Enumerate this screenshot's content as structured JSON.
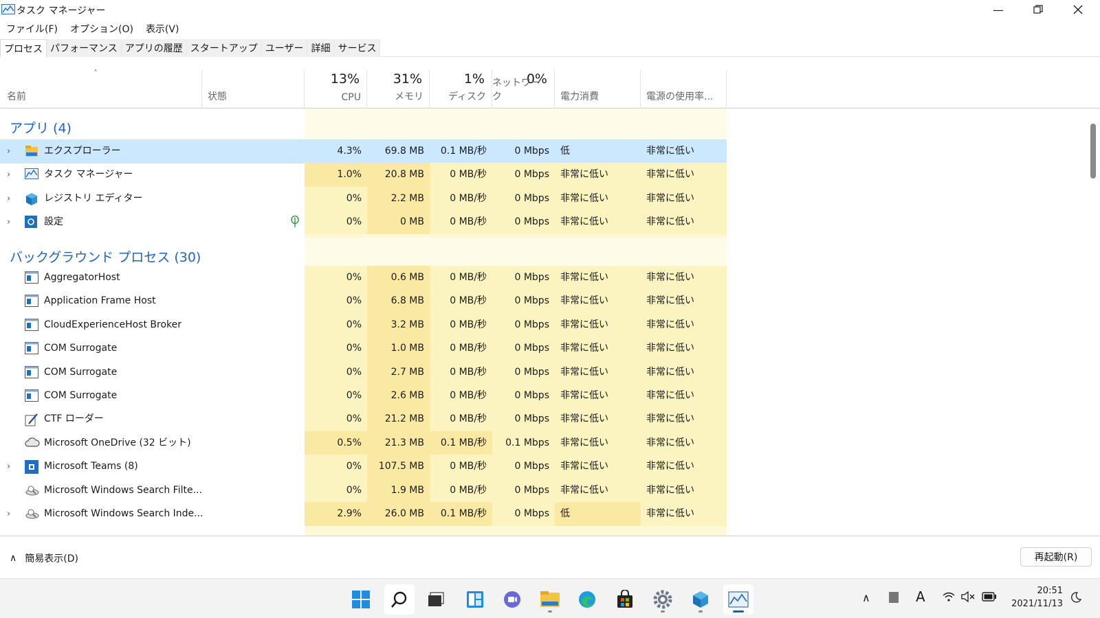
{
  "window": {
    "title": "タスク マネージャー",
    "minimize_icon": "minimize-icon",
    "maximize_icon": "restore-icon",
    "close_icon": "close-icon"
  },
  "menu": [
    "ファイル(F)",
    "オプション(O)",
    "表示(V)"
  ],
  "tabs": [
    "プロセス",
    "パフォーマンス",
    "アプリの履歴",
    "スタートアップ",
    "ユーザー",
    "詳細",
    "サービス"
  ],
  "active_tab": "プロセス",
  "columns": {
    "name": "名前",
    "status": "状態",
    "cpu_pct": "13%",
    "cpu": "CPU",
    "mem_pct": "31%",
    "mem": "メモリ",
    "disk_pct": "1%",
    "disk": "ディスク",
    "net_pct": "0%",
    "net": "ネットワーク",
    "power": "電力消費",
    "power_trend": "電源の使用率..."
  },
  "groups": {
    "apps": "アプリ (4)",
    "background": "バックグラウンド プロセス (30)"
  },
  "apps": [
    {
      "name": "エクスプローラー",
      "icon": "folder-icon",
      "expand": true,
      "cpu": "4.3%",
      "mem": "69.8 MB",
      "disk": "0.1 MB/秒",
      "net": "0 Mbps",
      "power": "低",
      "trend": "非常に低い",
      "selected": true
    },
    {
      "name": "タスク マネージャー",
      "icon": "task-manager-icon",
      "expand": true,
      "cpu": "1.0%",
      "mem": "20.8 MB",
      "disk": "0 MB/秒",
      "net": "0 Mbps",
      "power": "非常に低い",
      "trend": "非常に低い"
    },
    {
      "name": "レジストリ エディター",
      "icon": "registry-icon",
      "expand": true,
      "cpu": "0%",
      "mem": "2.2 MB",
      "disk": "0 MB/秒",
      "net": "0 Mbps",
      "power": "非常に低い",
      "trend": "非常に低い"
    },
    {
      "name": "設定",
      "icon": "settings-icon",
      "expand": true,
      "cpu": "0%",
      "mem": "0 MB",
      "disk": "0 MB/秒",
      "net": "0 Mbps",
      "power": "非常に低い",
      "trend": "非常に低い",
      "status_icon": "leaf-icon"
    }
  ],
  "background": [
    {
      "name": "AggregatorHost",
      "icon": "window-icon",
      "expand": false,
      "cpu": "0%",
      "mem": "0.6 MB",
      "disk": "0 MB/秒",
      "net": "0 Mbps",
      "power": "非常に低い",
      "trend": "非常に低い"
    },
    {
      "name": "Application Frame Host",
      "icon": "window-icon",
      "expand": false,
      "cpu": "0%",
      "mem": "6.8 MB",
      "disk": "0 MB/秒",
      "net": "0 Mbps",
      "power": "非常に低い",
      "trend": "非常に低い"
    },
    {
      "name": "CloudExperienceHost Broker",
      "icon": "window-icon",
      "expand": false,
      "cpu": "0%",
      "mem": "3.2 MB",
      "disk": "0 MB/秒",
      "net": "0 Mbps",
      "power": "非常に低い",
      "trend": "非常に低い"
    },
    {
      "name": "COM Surrogate",
      "icon": "window-icon",
      "expand": false,
      "cpu": "0%",
      "mem": "1.0 MB",
      "disk": "0 MB/秒",
      "net": "0 Mbps",
      "power": "非常に低い",
      "trend": "非常に低い"
    },
    {
      "name": "COM Surrogate",
      "icon": "window-icon",
      "expand": false,
      "cpu": "0%",
      "mem": "2.7 MB",
      "disk": "0 MB/秒",
      "net": "0 Mbps",
      "power": "非常に低い",
      "trend": "非常に低い"
    },
    {
      "name": "COM Surrogate",
      "icon": "window-icon",
      "expand": false,
      "cpu": "0%",
      "mem": "2.6 MB",
      "disk": "0 MB/秒",
      "net": "0 Mbps",
      "power": "非常に低い",
      "trend": "非常に低い"
    },
    {
      "name": "CTF ローダー",
      "icon": "ctf-icon",
      "expand": false,
      "cpu": "0%",
      "mem": "21.2 MB",
      "disk": "0 MB/秒",
      "net": "0 Mbps",
      "power": "非常に低い",
      "trend": "非常に低い"
    },
    {
      "name": "Microsoft OneDrive (32 ビット)",
      "icon": "cloud-icon",
      "expand": false,
      "cpu": "0.5%",
      "mem": "21.3 MB",
      "disk": "0.1 MB/秒",
      "net": "0.1 Mbps",
      "power": "非常に低い",
      "trend": "非常に低い"
    },
    {
      "name": "Microsoft Teams (8)",
      "icon": "teams-icon",
      "expand": true,
      "cpu": "0%",
      "mem": "107.5 MB",
      "disk": "0 MB/秒",
      "net": "0 Mbps",
      "power": "非常に低い",
      "trend": "非常に低い"
    },
    {
      "name": "Microsoft Windows Search Filte...",
      "icon": "search-filter-icon",
      "expand": false,
      "cpu": "0%",
      "mem": "1.9 MB",
      "disk": "0 MB/秒",
      "net": "0 Mbps",
      "power": "非常に低い",
      "trend": "非常に低い"
    },
    {
      "name": "Microsoft Windows Search Inde...",
      "icon": "search-indexer-icon",
      "expand": true,
      "cpu": "2.9%",
      "mem": "26.0 MB",
      "disk": "0.1 MB/秒",
      "net": "0 Mbps",
      "power": "低",
      "trend": "非常に低い"
    }
  ],
  "footer": {
    "collapse_label": "簡易表示(D)",
    "restart_label": "再起動(R)"
  },
  "taskbar": {
    "icons": [
      "start-icon",
      "search-icon",
      "task-view-icon",
      "widgets-icon",
      "chat-icon",
      "explorer-icon",
      "edge-icon",
      "store-icon",
      "settings-icon",
      "registry-icon",
      "task-manager-icon"
    ],
    "time": "20:51",
    "date": "2021/11/13"
  },
  "colors": {
    "accent": "#1f62c9",
    "selected_row": "#cce8ff",
    "heat_light": "#fbf3c0",
    "heat_dark": "#f9e9a3",
    "taskbar_active": "#0a64c8"
  }
}
